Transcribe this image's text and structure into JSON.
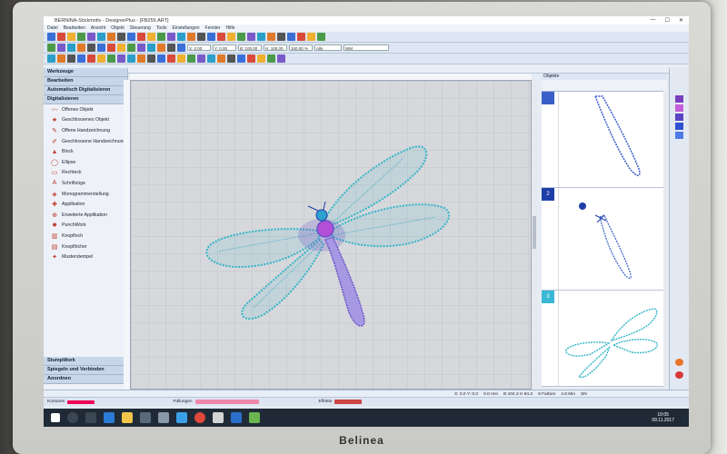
{
  "monitor": {
    "brand": "Belinea"
  },
  "window": {
    "title": "BERNINA-Stickmotiv - DesignerPlus - [FB259.ART]",
    "controls": [
      "—",
      "☐",
      "✕"
    ]
  },
  "menu": [
    "Datei",
    "Bearbeiten",
    "Ansicht",
    "Objekt",
    "Steuerung",
    "Tools",
    "Einstellungen",
    "Fenster",
    "Hilfe"
  ],
  "toolbar": {
    "fields": [
      "X: 0.00",
      "Y: 0.00",
      "B: 100.00",
      "H: 100.00",
      "100.00 %"
    ],
    "dropdown_value": "Alle",
    "search_value": "WM"
  },
  "left_panel": {
    "header": "Werkzeuge",
    "sections": [
      "Bearbeiten",
      "Automatisch Digitalisieren",
      "Digitalisieren"
    ],
    "tools": [
      {
        "label": "Offenes Objekt",
        "icon": "open-object"
      },
      {
        "label": "Geschlossenes Objekt",
        "icon": "closed-object"
      },
      {
        "label": "Offene Handzeichnung",
        "icon": "freehand-open"
      },
      {
        "label": "Geschlossene Handzeichnung",
        "icon": "freehand-closed"
      },
      {
        "label": "Block",
        "icon": "block"
      },
      {
        "label": "Ellipse",
        "icon": "ellipse"
      },
      {
        "label": "Rechteck",
        "icon": "rectangle"
      },
      {
        "label": "Schriftzüge",
        "icon": "lettering"
      },
      {
        "label": "Monogrammerstellung",
        "icon": "monogram"
      },
      {
        "label": "Applikation",
        "icon": "applique"
      },
      {
        "label": "Erweiterte Applikation",
        "icon": "advanced-applique"
      },
      {
        "label": "PunchWork",
        "icon": "punchwork"
      },
      {
        "label": "Knopfloch",
        "icon": "buttonhole"
      },
      {
        "label": "Knopflöcher",
        "icon": "buttonholes"
      },
      {
        "label": "Musterstempel",
        "icon": "pattern-stamp"
      }
    ],
    "bottom_sections": [
      "StumpWork",
      "Spiegeln und Verbinden",
      "Anordnen"
    ]
  },
  "objects_panel": {
    "title": "Objekte",
    "items": [
      {
        "number": "",
        "color": "#3b5fc8"
      },
      {
        "number": "2",
        "color": "#1f3fa8"
      },
      {
        "number": "3",
        "color": "#39b8d6"
      }
    ]
  },
  "status_bar": {
    "fields": [
      "X: 0.0 Y: 0.0",
      "0.0 mm",
      "B 104.3 H 84.3",
      "9 Farben",
      "4.8 Min",
      "SN"
    ]
  },
  "bottom_toolbar": {
    "labels": [
      "Konturen",
      "Füllungen",
      "Effekte"
    ]
  },
  "taskbar": {
    "time": "10:05",
    "date": "09.11.2017",
    "tray_text": "ENG"
  },
  "colors": {
    "dragonfly_wing": "#33b5c6",
    "dragonfly_body": "#6a55c8",
    "dragonfly_head": "#b24fd6"
  }
}
